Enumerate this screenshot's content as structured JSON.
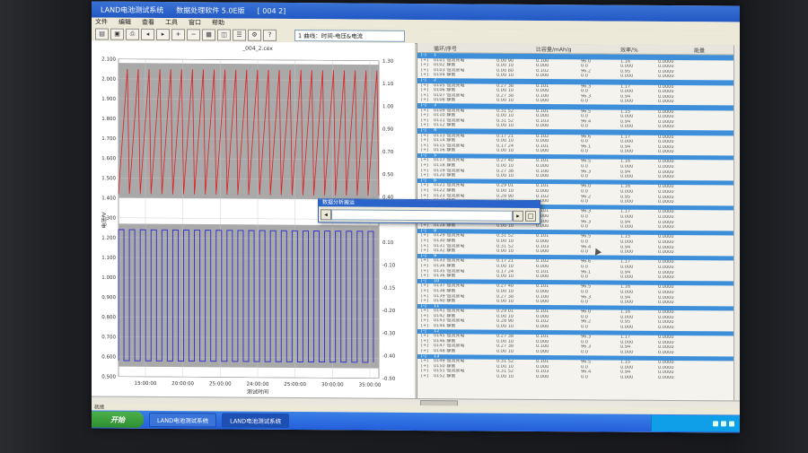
{
  "window": {
    "app_title": "LAND电池测试系统",
    "doc_title": "数据处理软件 5.0E版",
    "doc_id": "[ 004 2]"
  },
  "menu": [
    "文件",
    "编辑",
    "查看",
    "工具",
    "窗口",
    "帮助"
  ],
  "toolbar": {
    "view_select": "1 曲线：时间-电压&电流"
  },
  "chart": {
    "title": "_004_2.cex",
    "xlabel": "测试时间",
    "ylabel_left": "电压/V",
    "x_ticks": [
      "15:00:00",
      "20:00:00",
      "25:00:00",
      "24:00:00",
      "25:00:00",
      "30:00:00",
      "35:00:00"
    ],
    "y_left_ticks": [
      "2.100",
      "2.000",
      "1.900",
      "1.800",
      "1.700",
      "1.600",
      "1.500",
      "1.400",
      "1.300",
      "1.200",
      "1.100",
      "1.000",
      "0.900",
      "0.800",
      "0.700",
      "0.600",
      "0.500"
    ],
    "y_right_ticks": [
      "1.30",
      "1.10",
      "1.00",
      "0.90",
      "0.70",
      "0.50",
      "0.40",
      "0.30",
      "0.10",
      "-0.10",
      "-0.15",
      "-0.20",
      "-0.30",
      "-0.40",
      "-0.50"
    ],
    "colors": {
      "voltage": "#e02020",
      "current": "#2a2ad0",
      "plot_bg": "#a9a9a9"
    }
  },
  "chart_data": {
    "type": "line",
    "title": "_004_2.cex",
    "xlabel": "测试时间",
    "ylabel": "电压/V",
    "ylim": [
      0.5,
      2.1
    ],
    "y2lim": [
      -0.5,
      1.3
    ],
    "series": [
      {
        "cycles": 24,
        "min": 1.42,
        "max": 2.05,
        "axis": "left"
      },
      {
        "cycles": 24,
        "min": 0.58,
        "max": 1.24,
        "axis": "left"
      }
    ]
  },
  "table": {
    "headers": [
      "循环/序号",
      "",
      "比容量/mAh/g",
      "",
      "效率/%",
      "",
      "能量"
    ],
    "rows": [
      [
        "[-]",
        "1",
        "",
        "",
        "",
        "",
        ""
      ],
      [
        "[+]",
        "0101 恒流充电",
        "0.00 90",
        "0.100",
        "96.0",
        "1.16",
        "0.0000"
      ],
      [
        "[+]",
        "0102 静置",
        "0.00 10",
        "0.000",
        "0.0",
        "0.000",
        "0.0000"
      ],
      [
        "[+]",
        "0103 恒流放电",
        "0.00 80",
        "0.102",
        "96.2",
        "0.95",
        "0.0000"
      ],
      [
        "[+]",
        "0104 静置",
        "0.00 10",
        "0.000",
        "0.0",
        "0.000",
        "0.0000"
      ],
      [
        "[-]",
        "2",
        "",
        "",
        "",
        "",
        ""
      ],
      [
        "[+]",
        "0105 恒流充电",
        "0.27 38",
        "0.101",
        "96.3",
        "1.17",
        "0.0000"
      ],
      [
        "[+]",
        "0106 静置",
        "0.00 10",
        "0.000",
        "0.0",
        "0.000",
        "0.0000"
      ],
      [
        "[+]",
        "0107 恒流放电",
        "0.27 38",
        "0.100",
        "96.3",
        "0.94",
        "0.0000"
      ],
      [
        "[+]",
        "0108 静置",
        "0.00 10",
        "0.000",
        "0.0",
        "0.000",
        "0.0000"
      ],
      [
        "[-]",
        "3",
        "",
        "",
        "",
        "",
        ""
      ],
      [
        "[+]",
        "0109 恒流充电",
        "0.31 52",
        "0.101",
        "96.5",
        "1.15",
        "0.0000"
      ],
      [
        "[+]",
        "0110 静置",
        "0.00 10",
        "0.000",
        "0.0",
        "0.000",
        "0.0000"
      ],
      [
        "[+]",
        "0111 恒流放电",
        "0.31 52",
        "0.103",
        "96.4",
        "0.94",
        "0.0000"
      ],
      [
        "[+]",
        "0112 静置",
        "0.00 10",
        "0.000",
        "0.0",
        "0.000",
        "0.0000"
      ],
      [
        "[-]",
        "4",
        "",
        "",
        "",
        "",
        ""
      ],
      [
        "[+]",
        "0113 恒流充电",
        "0.17 21",
        "0.102",
        "96.6",
        "1.17",
        "0.0000"
      ],
      [
        "[+]",
        "0114 静置",
        "0.00 10",
        "0.000",
        "0.0",
        "0.000",
        "0.0000"
      ],
      [
        "[+]",
        "0115 恒流放电",
        "0.17 24",
        "0.101",
        "96.1",
        "0.94",
        "0.0000"
      ],
      [
        "[+]",
        "0116 静置",
        "0.00 10",
        "0.000",
        "0.0",
        "0.000",
        "0.0000"
      ],
      [
        "[-]",
        "5",
        "",
        "",
        "",
        "",
        ""
      ],
      [
        "[+]",
        "0117 恒流充电",
        "0.27 40",
        "0.101",
        "96.5",
        "1.16",
        "0.0000"
      ],
      [
        "[+]",
        "0118 静置",
        "0.00 10",
        "0.000",
        "0.0",
        "0.000",
        "0.0000"
      ],
      [
        "[+]",
        "0119 恒流放电",
        "0.27 38",
        "0.100",
        "96.3",
        "0.94",
        "0.0000"
      ],
      [
        "[+]",
        "0120 静置",
        "0.00 10",
        "0.000",
        "0.0",
        "0.000",
        "0.0000"
      ],
      [
        "[-]",
        "6",
        "",
        "",
        "",
        "",
        ""
      ],
      [
        "[+]",
        "0121 恒流充电",
        "0.29 01",
        "0.101",
        "96.0",
        "1.16",
        "0.0000"
      ],
      [
        "[+]",
        "0122 静置",
        "0.00 10",
        "0.000",
        "0.0",
        "0.000",
        "0.0000"
      ],
      [
        "[+]",
        "0123 恒流放电",
        "0.28 90",
        "0.102",
        "96.2",
        "0.95",
        "0.0000"
      ],
      [
        "[+]",
        "0124 静置",
        "0.00 10",
        "0.000",
        "0.0",
        "0.000",
        "0.0000"
      ],
      [
        "[-]",
        "7",
        "",
        "",
        "",
        "",
        ""
      ],
      [
        "[+]",
        "0125 恒流充电",
        "0.27 38",
        "0.101",
        "96.3",
        "1.17",
        "0.0000"
      ],
      [
        "[+]",
        "0126 静置",
        "0.00 10",
        "0.000",
        "0.0",
        "0.000",
        "0.0000"
      ],
      [
        "[+]",
        "0127 恒流放电",
        "0.27 38",
        "0.100",
        "96.3",
        "0.94",
        "0.0000"
      ],
      [
        "[+]",
        "0128 静置",
        "0.00 10",
        "0.000",
        "0.0",
        "0.000",
        "0.0000"
      ],
      [
        "[-]",
        "8",
        "",
        "",
        "",
        "",
        ""
      ],
      [
        "[+]",
        "0129 恒流充电",
        "0.31 52",
        "0.101",
        "96.5",
        "1.15",
        "0.0000"
      ],
      [
        "[+]",
        "0130 静置",
        "0.00 10",
        "0.000",
        "0.0",
        "0.000",
        "0.0000"
      ],
      [
        "[+]",
        "0131 恒流放电",
        "0.31 52",
        "0.103",
        "96.4",
        "0.94",
        "0.0000"
      ],
      [
        "[+]",
        "0132 静置",
        "0.00 10",
        "0.000",
        "0.0",
        "0.000",
        "0.0000"
      ],
      [
        "[-]",
        "9",
        "",
        "",
        "",
        "",
        ""
      ],
      [
        "[+]",
        "0133 恒流充电",
        "0.17 21",
        "0.102",
        "96.6",
        "1.17",
        "0.0000"
      ],
      [
        "[+]",
        "0134 静置",
        "0.00 10",
        "0.000",
        "0.0",
        "0.000",
        "0.0000"
      ],
      [
        "[+]",
        "0135 恒流放电",
        "0.17 24",
        "0.101",
        "96.1",
        "0.94",
        "0.0000"
      ],
      [
        "[+]",
        "0136 静置",
        "0.00 10",
        "0.000",
        "0.0",
        "0.000",
        "0.0000"
      ],
      [
        "[-]",
        "10",
        "",
        "",
        "",
        "",
        ""
      ],
      [
        "[+]",
        "0137 恒流充电",
        "0.27 40",
        "0.101",
        "96.5",
        "1.16",
        "0.0000"
      ],
      [
        "[+]",
        "0138 静置",
        "0.00 10",
        "0.000",
        "0.0",
        "0.000",
        "0.0000"
      ],
      [
        "[+]",
        "0139 恒流放电",
        "0.27 38",
        "0.100",
        "96.3",
        "0.94",
        "0.0000"
      ],
      [
        "[+]",
        "0140 静置",
        "0.00 10",
        "0.000",
        "0.0",
        "0.000",
        "0.0000"
      ],
      [
        "[-]",
        "11",
        "",
        "",
        "",
        "",
        ""
      ],
      [
        "[+]",
        "0141 恒流充电",
        "0.29 01",
        "0.101",
        "96.0",
        "1.16",
        "0.0000"
      ],
      [
        "[+]",
        "0142 静置",
        "0.00 10",
        "0.000",
        "0.0",
        "0.000",
        "0.0000"
      ],
      [
        "[+]",
        "0143 恒流放电",
        "0.28 90",
        "0.102",
        "96.2",
        "0.95",
        "0.0000"
      ],
      [
        "[+]",
        "0144 静置",
        "0.00 10",
        "0.000",
        "0.0",
        "0.000",
        "0.0000"
      ],
      [
        "[-]",
        "12",
        "",
        "",
        "",
        "",
        ""
      ],
      [
        "[+]",
        "0145 恒流充电",
        "0.27 38",
        "0.101",
        "96.3",
        "1.17",
        "0.0000"
      ],
      [
        "[+]",
        "0146 静置",
        "0.00 10",
        "0.000",
        "0.0",
        "0.000",
        "0.0000"
      ],
      [
        "[+]",
        "0147 恒流放电",
        "0.27 38",
        "0.100",
        "96.3",
        "0.94",
        "0.0000"
      ],
      [
        "[+]",
        "0148 静置",
        "0.00 10",
        "0.000",
        "0.0",
        "0.000",
        "0.0000"
      ],
      [
        "[-]",
        "13",
        "",
        "",
        "",
        "",
        ""
      ],
      [
        "[+]",
        "0149 恒流充电",
        "0.31 52",
        "0.101",
        "96.5",
        "1.15",
        "0.0000"
      ],
      [
        "[+]",
        "0150 静置",
        "0.00 10",
        "0.000",
        "0.0",
        "0.000",
        "0.0000"
      ],
      [
        "[+]",
        "0151 恒流放电",
        "0.31 52",
        "0.103",
        "96.4",
        "0.94",
        "0.0000"
      ],
      [
        "[+]",
        "0152 静置",
        "0.00 10",
        "0.000",
        "0.0",
        "0.000",
        "0.0000"
      ]
    ]
  },
  "popup": {
    "title": "数据分析搬运"
  },
  "status": {
    "left": "就绪"
  },
  "taskbar": {
    "start": "开始",
    "tasks": [
      "LAND电池测试系统",
      "LAND电池测试系统"
    ]
  }
}
